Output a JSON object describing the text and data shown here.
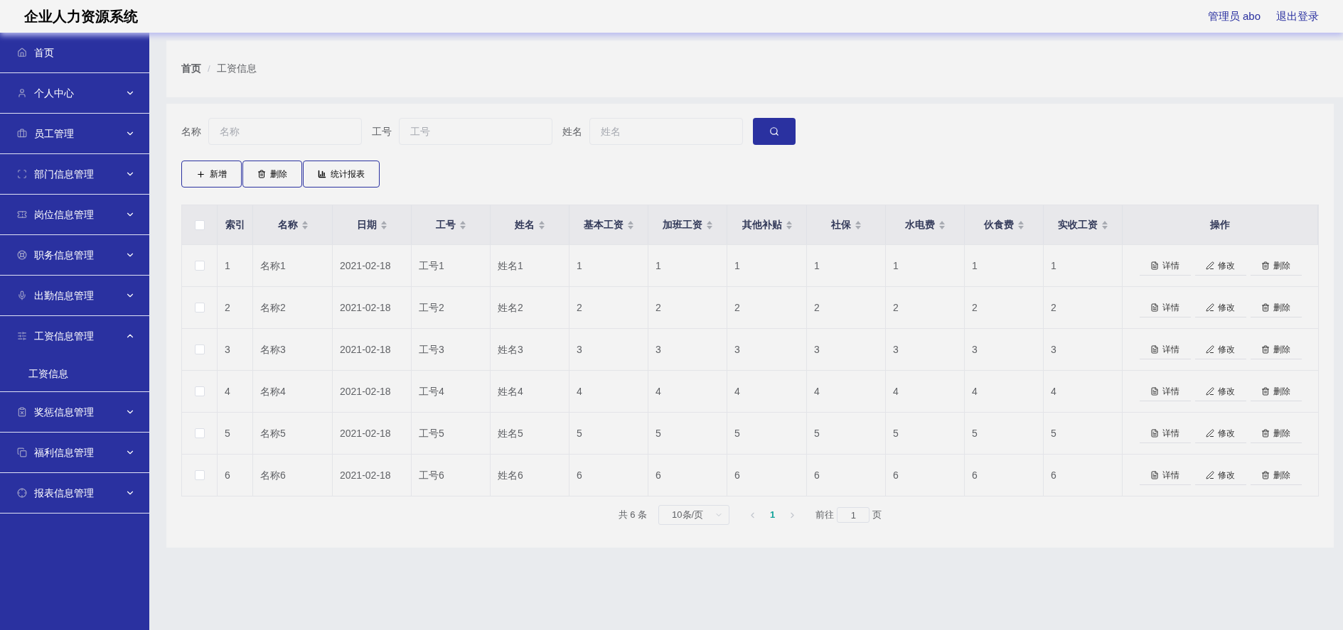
{
  "header": {
    "title": "企业人力资源系统",
    "user": "管理员 abo",
    "logout": "退出登录"
  },
  "sidebar": {
    "items": [
      {
        "label": "首页"
      },
      {
        "label": "个人中心",
        "has_arrow": true,
        "expanded": false
      },
      {
        "label": "员工管理",
        "has_arrow": true,
        "expanded": false
      },
      {
        "label": "部门信息管理",
        "has_arrow": true,
        "expanded": false
      },
      {
        "label": "岗位信息管理",
        "has_arrow": true,
        "expanded": false
      },
      {
        "label": "职务信息管理",
        "has_arrow": true,
        "expanded": false
      },
      {
        "label": "出勤信息管理",
        "has_arrow": true,
        "expanded": false
      },
      {
        "label": "工资信息管理",
        "has_arrow": true,
        "expanded": true,
        "children": [
          {
            "label": "工资信息"
          }
        ]
      },
      {
        "label": "奖惩信息管理",
        "has_arrow": true,
        "expanded": false
      },
      {
        "label": "福利信息管理",
        "has_arrow": true,
        "expanded": false
      },
      {
        "label": "报表信息管理",
        "has_arrow": true,
        "expanded": false
      }
    ]
  },
  "breadcrumb": {
    "items": [
      "首页",
      "工资信息"
    ],
    "separator": "/"
  },
  "search": {
    "fields": [
      {
        "label": "名称",
        "placeholder": "名称"
      },
      {
        "label": "工号",
        "placeholder": "工号"
      },
      {
        "label": "姓名",
        "placeholder": "姓名"
      }
    ]
  },
  "actions": [
    {
      "kind": "add",
      "label": "新增"
    },
    {
      "kind": "delete",
      "label": "删除"
    },
    {
      "kind": "chart",
      "label": "统计报表"
    }
  ],
  "table": {
    "select_all_checked": false,
    "columns": [
      {
        "label": "索引",
        "sortable": false
      },
      {
        "label": "名称",
        "sortable": true
      },
      {
        "label": "日期",
        "sortable": true
      },
      {
        "label": "工号",
        "sortable": true
      },
      {
        "label": "姓名",
        "sortable": true
      },
      {
        "label": "基本工资",
        "sortable": true
      },
      {
        "label": "加班工资",
        "sortable": true
      },
      {
        "label": "其他补贴",
        "sortable": true
      },
      {
        "label": "社保",
        "sortable": true
      },
      {
        "label": "水电费",
        "sortable": true
      },
      {
        "label": "伙食费",
        "sortable": true
      },
      {
        "label": "实收工资",
        "sortable": true
      },
      {
        "label": "操作",
        "sortable": false
      }
    ],
    "rows": [
      {
        "checked": false,
        "cells": [
          "1",
          "名称1",
          "2021-02-18",
          "工号1",
          "姓名1",
          "1",
          "1",
          "1",
          "1",
          "1",
          "1",
          "1"
        ],
        "actions": [
          {
            "kind": "detail",
            "label": "详情"
          },
          {
            "kind": "edit",
            "label": "修改"
          },
          {
            "kind": "delete",
            "label": "删除"
          }
        ]
      },
      {
        "checked": false,
        "cells": [
          "2",
          "名称2",
          "2021-02-18",
          "工号2",
          "姓名2",
          "2",
          "2",
          "2",
          "2",
          "2",
          "2",
          "2"
        ],
        "actions": [
          {
            "kind": "detail",
            "label": "详情"
          },
          {
            "kind": "edit",
            "label": "修改"
          },
          {
            "kind": "delete",
            "label": "删除"
          }
        ]
      },
      {
        "checked": false,
        "cells": [
          "3",
          "名称3",
          "2021-02-18",
          "工号3",
          "姓名3",
          "3",
          "3",
          "3",
          "3",
          "3",
          "3",
          "3"
        ],
        "actions": [
          {
            "kind": "detail",
            "label": "详情"
          },
          {
            "kind": "edit",
            "label": "修改"
          },
          {
            "kind": "delete",
            "label": "删除"
          }
        ]
      },
      {
        "checked": false,
        "cells": [
          "4",
          "名称4",
          "2021-02-18",
          "工号4",
          "姓名4",
          "4",
          "4",
          "4",
          "4",
          "4",
          "4",
          "4"
        ],
        "actions": [
          {
            "kind": "detail",
            "label": "详情"
          },
          {
            "kind": "edit",
            "label": "修改"
          },
          {
            "kind": "delete",
            "label": "删除"
          }
        ]
      },
      {
        "checked": false,
        "cells": [
          "5",
          "名称5",
          "2021-02-18",
          "工号5",
          "姓名5",
          "5",
          "5",
          "5",
          "5",
          "5",
          "5",
          "5"
        ],
        "actions": [
          {
            "kind": "detail",
            "label": "详情"
          },
          {
            "kind": "edit",
            "label": "修改"
          },
          {
            "kind": "delete",
            "label": "删除"
          }
        ]
      },
      {
        "checked": false,
        "cells": [
          "6",
          "名称6",
          "2021-02-18",
          "工号6",
          "姓名6",
          "6",
          "6",
          "6",
          "6",
          "6",
          "6",
          "6"
        ],
        "actions": [
          {
            "kind": "detail",
            "label": "详情"
          },
          {
            "kind": "edit",
            "label": "修改"
          },
          {
            "kind": "delete",
            "label": "删除"
          }
        ]
      }
    ]
  },
  "pagination": {
    "total": "共 6 条",
    "page_size": "10条/页",
    "pages": [
      {
        "label": "1",
        "selected": true
      }
    ],
    "goto_label": "前往",
    "goto_value": "1",
    "goto_suffix": "页"
  }
}
